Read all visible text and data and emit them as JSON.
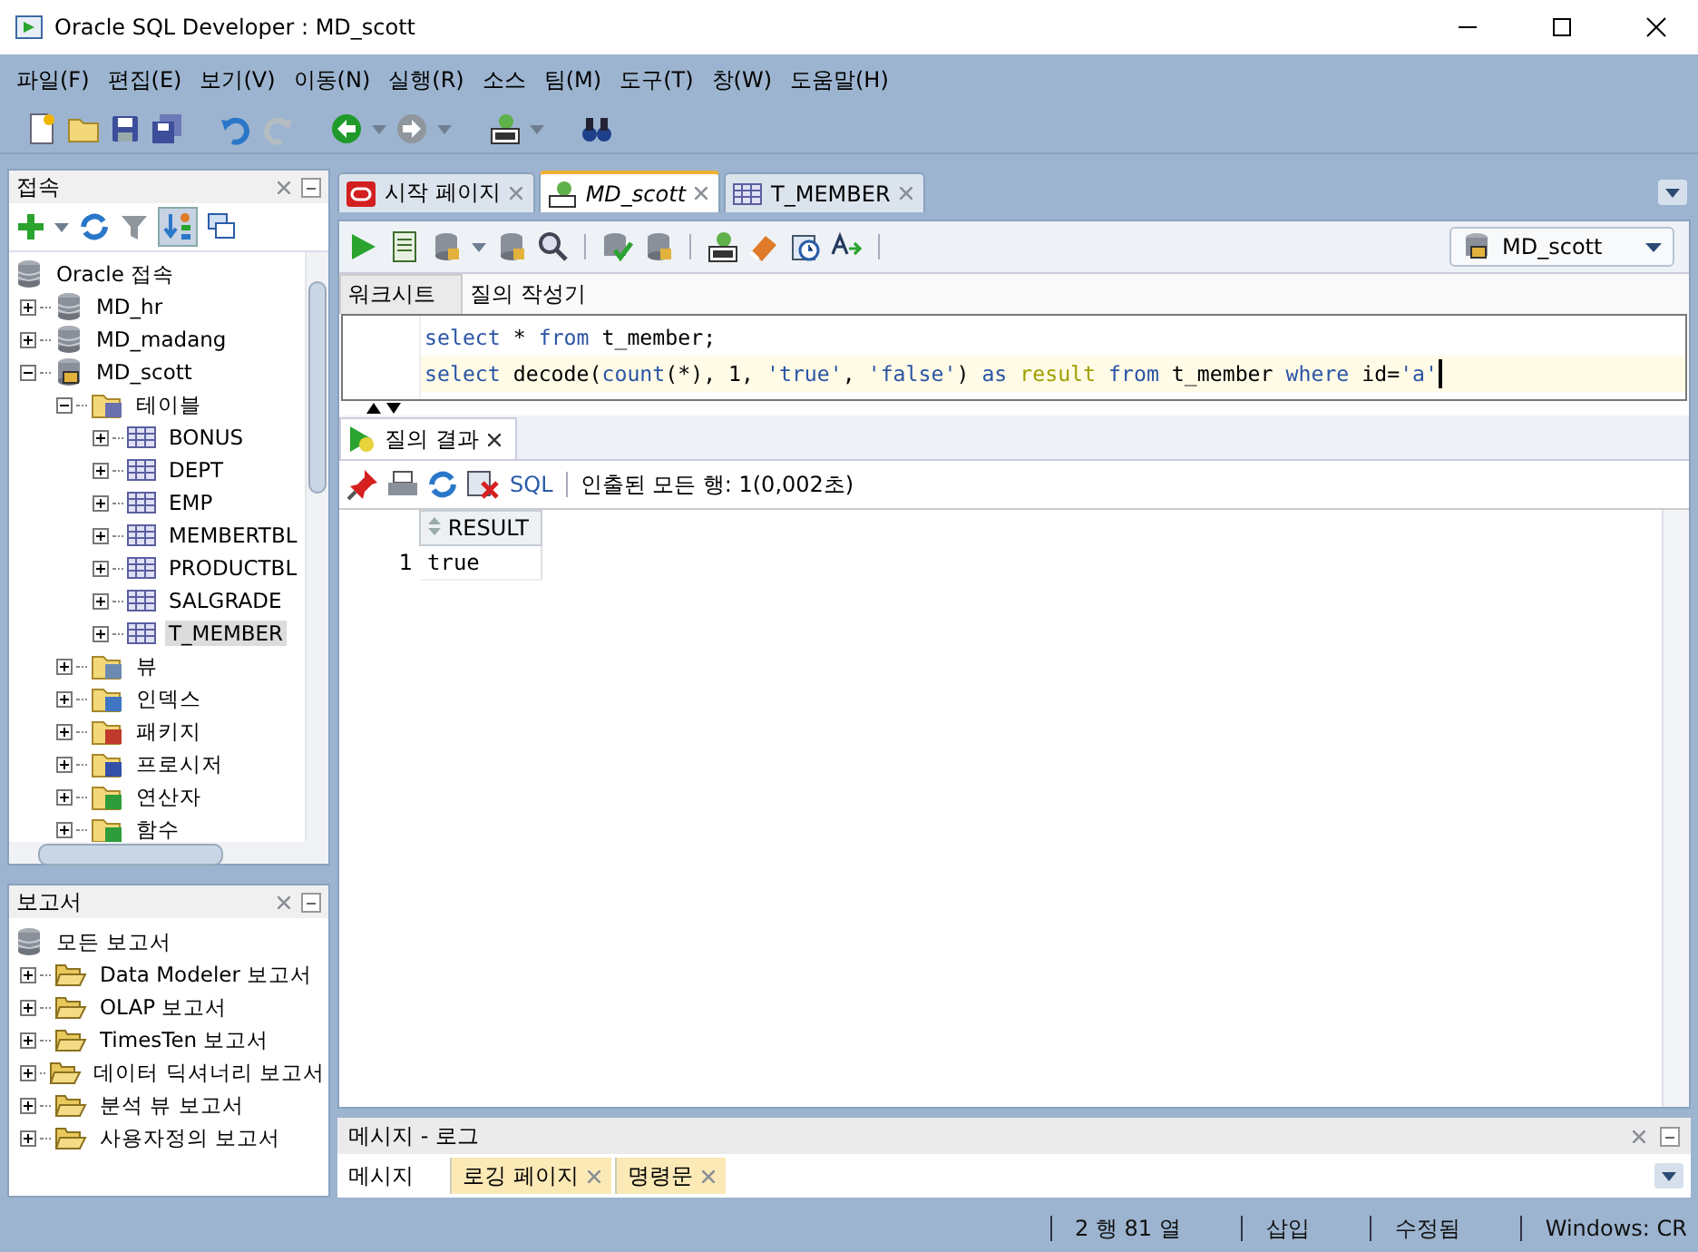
{
  "window": {
    "title": "Oracle SQL Developer : MD_scott"
  },
  "menu": [
    "파일(F)",
    "편집(E)",
    "보기(V)",
    "이동(N)",
    "실행(R)",
    "소스",
    "팀(M)",
    "도구(T)",
    "창(W)",
    "도움말(H)"
  ],
  "connections": {
    "title": "접속",
    "tree": [
      {
        "label": "Oracle 접속",
        "kind": "root",
        "selected": false,
        "children": [
          {
            "label": "MD_hr",
            "kind": "database",
            "expanded": false,
            "selected": false
          },
          {
            "label": "MD_madang",
            "kind": "database",
            "expanded": false,
            "selected": false
          },
          {
            "label": "MD_scott",
            "kind": "connection",
            "expanded": true,
            "selected": false,
            "children": [
              {
                "label": "테이블",
                "kind": "table-folder",
                "expanded": true,
                "selected": false,
                "children": [
                  {
                    "label": "BONUS",
                    "kind": "table",
                    "expanded": false,
                    "selected": false
                  },
                  {
                    "label": "DEPT",
                    "kind": "table",
                    "expanded": false,
                    "selected": false
                  },
                  {
                    "label": "EMP",
                    "kind": "table",
                    "expanded": false,
                    "selected": false
                  },
                  {
                    "label": "MEMBERTBL",
                    "kind": "table",
                    "expanded": false,
                    "selected": false
                  },
                  {
                    "label": "PRODUCTBL",
                    "kind": "table",
                    "expanded": false,
                    "selected": false
                  },
                  {
                    "label": "SALGRADE",
                    "kind": "table",
                    "expanded": false,
                    "selected": false
                  },
                  {
                    "label": "T_MEMBER",
                    "kind": "table",
                    "expanded": false,
                    "selected": true
                  }
                ]
              },
              {
                "label": "뷰",
                "kind": "view-folder",
                "expanded": false,
                "selected": false
              },
              {
                "label": "인덱스",
                "kind": "index-folder",
                "expanded": false,
                "selected": false
              },
              {
                "label": "패키지",
                "kind": "package-folder",
                "expanded": false,
                "selected": false
              },
              {
                "label": "프로시저",
                "kind": "procedure-folder",
                "expanded": false,
                "selected": false
              },
              {
                "label": "연산자",
                "kind": "operator-folder",
                "expanded": false,
                "selected": false
              },
              {
                "label": "함수",
                "kind": "function-folder",
                "expanded": false,
                "selected": false
              }
            ]
          }
        ]
      }
    ]
  },
  "reports": {
    "title": "보고서",
    "tree": [
      {
        "label": "모든 보고서",
        "kind": "root",
        "children": [
          {
            "label": "Data Modeler 보고서",
            "kind": "report-folder",
            "expanded": false
          },
          {
            "label": "OLAP 보고서",
            "kind": "report-folder",
            "expanded": false
          },
          {
            "label": "TimesTen 보고서",
            "kind": "report-folder",
            "expanded": false
          },
          {
            "label": "데이터 딕셔너리 보고서",
            "kind": "report-folder",
            "expanded": false
          },
          {
            "label": "분석 뷰 보고서",
            "kind": "report-folder",
            "expanded": false
          },
          {
            "label": "사용자정의 보고서",
            "kind": "report-folder",
            "expanded": false
          }
        ]
      }
    ]
  },
  "editor_tabs": [
    {
      "label": "시작 페이지",
      "kind": "start",
      "selected": false
    },
    {
      "label": "MD_scott",
      "kind": "sql",
      "selected": true
    },
    {
      "label": "T_MEMBER",
      "kind": "table",
      "selected": false
    }
  ],
  "connection_selector": {
    "value": "MD_scott"
  },
  "worksheet_tabs": [
    {
      "label": "워크시트",
      "selected": true
    },
    {
      "label": "질의 작성기",
      "selected": false
    }
  ],
  "code_lines": [
    {
      "current": false,
      "tokens": [
        {
          "t": "select",
          "kind": "keyword"
        },
        {
          "t": " * ",
          "kind": "plain"
        },
        {
          "t": "from",
          "kind": "keyword"
        },
        {
          "t": " t_member;",
          "kind": "plain"
        }
      ]
    },
    {
      "current": true,
      "tokens": [
        {
          "t": "select",
          "kind": "keyword"
        },
        {
          "t": " decode(",
          "kind": "plain"
        },
        {
          "t": "count",
          "kind": "keyword"
        },
        {
          "t": "(*), 1, ",
          "kind": "plain"
        },
        {
          "t": "'true'",
          "kind": "string"
        },
        {
          "t": ", ",
          "kind": "plain"
        },
        {
          "t": "'false'",
          "kind": "string"
        },
        {
          "t": ") ",
          "kind": "plain"
        },
        {
          "t": "as",
          "kind": "keyword"
        },
        {
          "t": " result",
          "kind": "alias"
        },
        {
          "t": " from",
          "kind": "keyword"
        },
        {
          "t": " t_member ",
          "kind": "plain"
        },
        {
          "t": "where",
          "kind": "keyword"
        },
        {
          "t": " id=",
          "kind": "plain"
        },
        {
          "t": "'a'",
          "kind": "string"
        }
      ]
    }
  ],
  "results": {
    "tab": "질의 결과",
    "sql_link": "SQL",
    "status": "인출된 모든 행: 1(0,002초)",
    "columns": [
      "RESULT"
    ],
    "rows": [
      {
        "number": "1",
        "cells": [
          "true"
        ]
      }
    ]
  },
  "messages": {
    "title": "메시지 - 로그",
    "tabs": [
      {
        "label": "메시지",
        "selected": true,
        "closable": false
      },
      {
        "label": "로깅 페이지",
        "selected": false,
        "closable": true
      },
      {
        "label": "명령문",
        "selected": false,
        "closable": true
      }
    ]
  },
  "status_bar": [
    "2 행 81 열",
    "삽입",
    "수정됨",
    "Windows: CR"
  ]
}
